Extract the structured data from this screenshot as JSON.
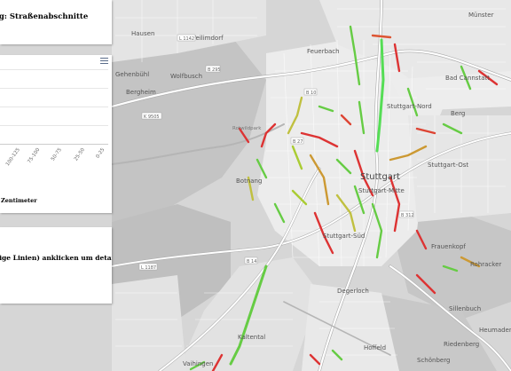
{
  "panel_title": "rung: Straßenabschnitte",
  "chart": {
    "menu_icon": "hamburger-icon",
    "x_ticks": [
      "100-125",
      "75-100",
      "50-75",
      "25-50",
      "0-25"
    ],
    "caption": "n Zentimeter"
  },
  "info_text": "rbige Linien) anklicken um detailierte",
  "map_labels": {
    "hausen": "Hausen",
    "weilimdorf": "Weilimdorf",
    "gehenbuehl": "Gehenbühl",
    "wolfbusch": "Wolfbusch",
    "bergheim": "Bergheim",
    "feuerbach": "Feuerbach",
    "muenster": "Münster",
    "bad_cannstatt": "Bad Cannstatt",
    "stuttgart_nord": "Stuttgart-Nord",
    "berg": "Berg",
    "stuttgart_ost": "Stuttgart-Ost",
    "botnang": "Botnang",
    "stuttgart": "Stuttgart",
    "stuttgart_mitte": "Stuttgart-Mitte",
    "stuttgart_sued": "Stuttgart-Süd",
    "frauenkopf": "Frauenkopf",
    "ruhbaecker": "Rohracker",
    "degerloch": "Degerloch",
    "sillenbuch": "Sillenbuch",
    "heumaden": "Heumaden",
    "kaltental": "Kaltental",
    "hoffeld": "Hoffeld",
    "riedenberg": "Riedenberg",
    "schoenberg": "Schönberg",
    "vaihingen": "Vaihingen",
    "rotwildpark": "Rotwildpark"
  },
  "road_refs": [
    "L 1142",
    "B 295",
    "B 10",
    "B 27",
    "L 1187",
    "B 14",
    "B 312",
    "K 9505"
  ]
}
